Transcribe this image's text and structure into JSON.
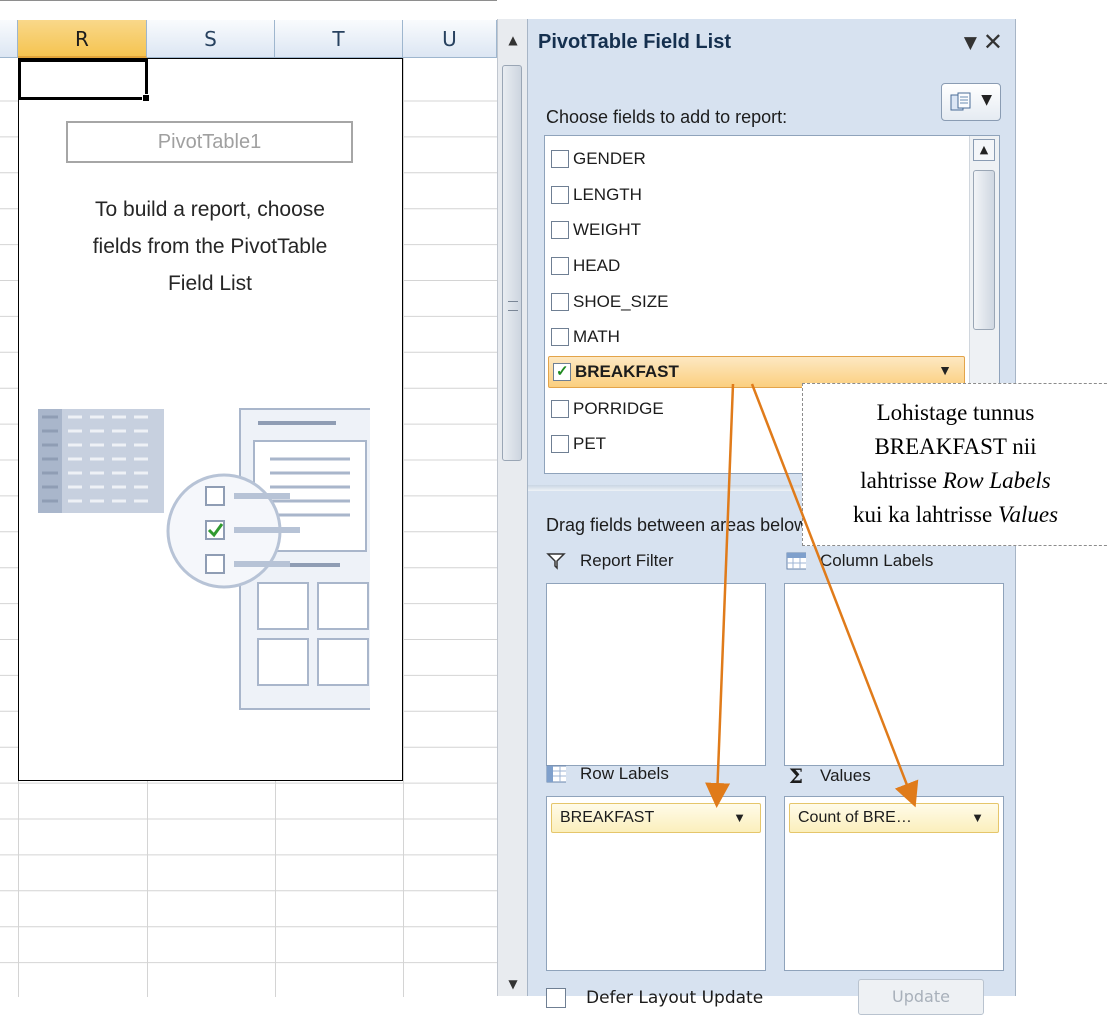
{
  "columns": [
    "R",
    "S",
    "T",
    "U"
  ],
  "selected_column": "R",
  "pivot_placeholder": {
    "name": "PivotTable1",
    "instructions": "To build a report, choose\nfields from the PivotTable\nField List"
  },
  "field_list": {
    "title": "PivotTable Field List",
    "choose_label": "Choose fields to add to report:",
    "fields": [
      {
        "label": "GENDER",
        "checked": false
      },
      {
        "label": "LENGTH",
        "checked": false
      },
      {
        "label": "WEIGHT",
        "checked": false
      },
      {
        "label": "HEAD",
        "checked": false
      },
      {
        "label": "SHOE_SIZE",
        "checked": false
      },
      {
        "label": "MATH",
        "checked": false
      },
      {
        "label": "BREAKFAST",
        "checked": true
      },
      {
        "label": "PORRIDGE",
        "checked": false
      },
      {
        "label": "PET",
        "checked": false
      }
    ],
    "drag_label": "Drag fields between areas below:",
    "areas": {
      "report_filter": {
        "label": "Report Filter"
      },
      "column_labels": {
        "label": "Column Labels"
      },
      "row_labels": {
        "label": "Row Labels",
        "item": "BREAKFAST"
      },
      "values": {
        "label": "Values",
        "item": "Count of BRE…"
      }
    },
    "defer_label": "Defer Layout Update",
    "update_label": "Update"
  },
  "annotation": {
    "line1": "Lohistage tunnus",
    "line2": "BREAKFAST nii",
    "line3_prefix": "lahtrisse ",
    "line3_italic": "Row Labels",
    "line4_prefix": "kui ka lahtrisse ",
    "line4_italic": "Values"
  },
  "colors": {
    "arrow": "#e07b1a",
    "pane_bg": "#d7e2f0",
    "selected_header": "#f5c451"
  }
}
